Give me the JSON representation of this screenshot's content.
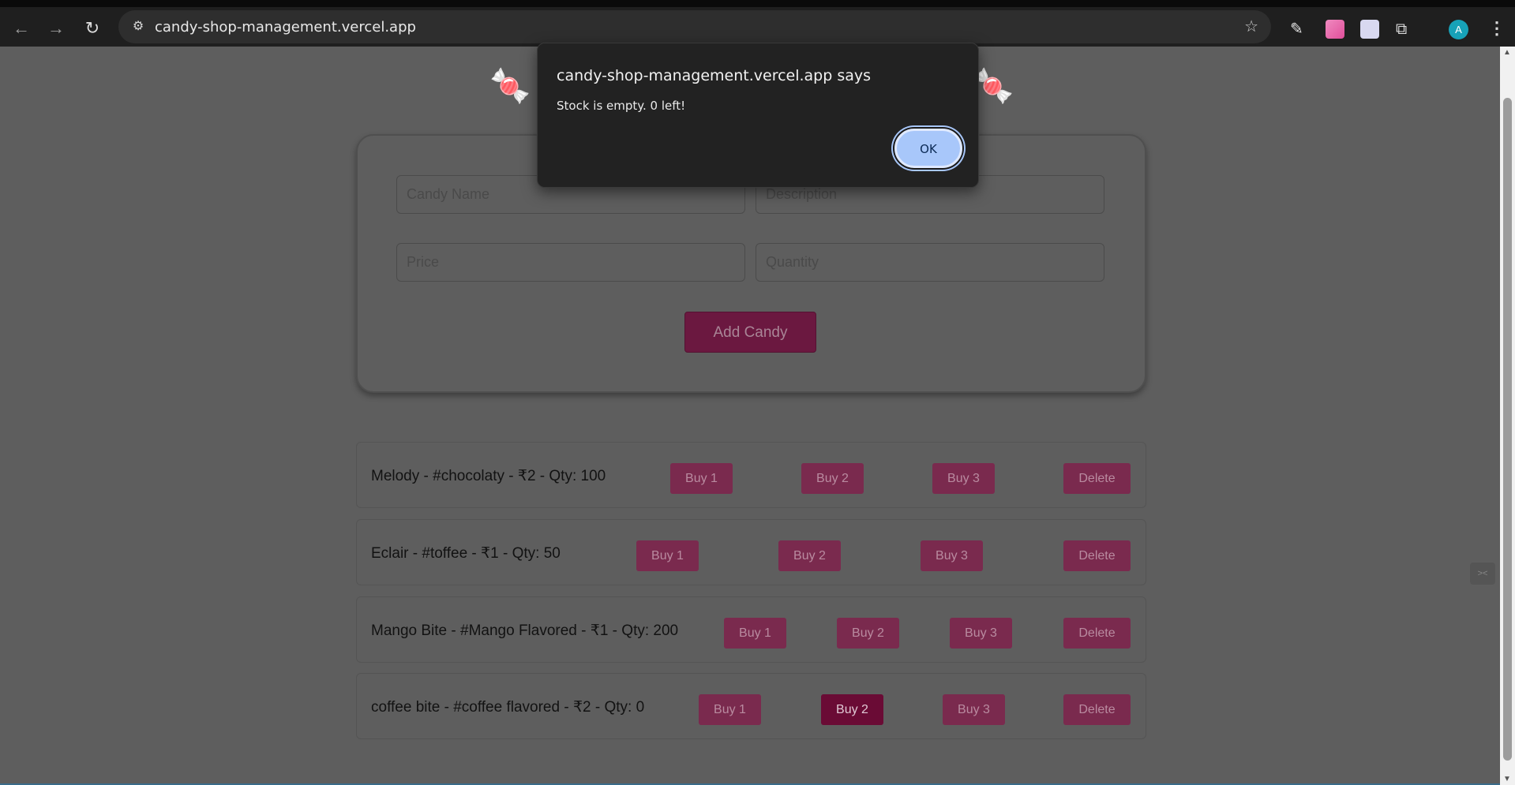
{
  "browser": {
    "url": "candy-shop-management.vercel.app",
    "profile_initial": "A"
  },
  "dialog": {
    "title": "candy-shop-management.vercel.app says",
    "message": "Stock is empty. 0 left!",
    "ok_label": "OK"
  },
  "form": {
    "name_placeholder": "Candy Name",
    "description_placeholder": "Description",
    "price_placeholder": "Price",
    "quantity_placeholder": "Quantity",
    "add_label": "Add Candy"
  },
  "candies": [
    {
      "label": "Melody - #chocolaty - ₹2 - Qty: 100",
      "buy1": "Buy 1",
      "buy2": "Buy 2",
      "buy3": "Buy 3",
      "delete": "Delete"
    },
    {
      "label": "Eclair - #toffee - ₹1 - Qty: 50",
      "buy1": "Buy 1",
      "buy2": "Buy 2",
      "buy3": "Buy 3",
      "delete": "Delete"
    },
    {
      "label": "Mango Bite - #Mango Flavored - ₹1 - Qty: 200",
      "buy1": "Buy 1",
      "buy2": "Buy 2",
      "buy3": "Buy 3",
      "delete": "Delete"
    },
    {
      "label": "coffee bite - #coffee flavored - ₹2 - Qty: 0",
      "buy1": "Buy 1",
      "buy2": "Buy 2",
      "buy3": "Buy 3",
      "delete": "Delete"
    }
  ],
  "icons": {
    "back": "arrow-left-icon",
    "forward": "arrow-right-icon",
    "reload": "reload-icon",
    "site_info": "tune-icon",
    "bookmark": "star-icon",
    "candy": "candy-icon"
  },
  "colors": {
    "primary_button": "#6b1840",
    "dialog_ok": "#a8c7fa"
  }
}
